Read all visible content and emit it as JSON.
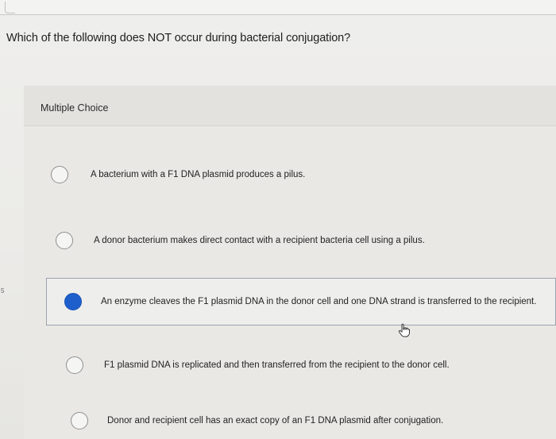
{
  "question": {
    "text": "Which of the following does NOT occur during bacterial conjugation?"
  },
  "question_type": {
    "label": "Multiple Choice"
  },
  "left_mark": "5",
  "options": [
    {
      "text": "A bacterium with a F1 DNA plasmid produces a pilus.",
      "selected": false
    },
    {
      "text": "A donor bacterium makes direct contact with a recipient bacteria cell using a pilus.",
      "selected": false
    },
    {
      "text": "An enzyme cleaves the F1 plasmid DNA in the donor cell and one DNA strand is transferred to the recipient.",
      "selected": true
    },
    {
      "text": "F1 plasmid DNA is replicated and then transferred from the recipient to the donor cell.",
      "selected": false
    },
    {
      "text": "Donor and recipient cell has an exact copy of an F1 DNA plasmid after conjugation.",
      "selected": false
    }
  ],
  "colors": {
    "selected_radio": "#1e5fcc",
    "selected_border": "#9aa3ad"
  },
  "icons": {
    "cursor": "hand-pointer-icon"
  }
}
